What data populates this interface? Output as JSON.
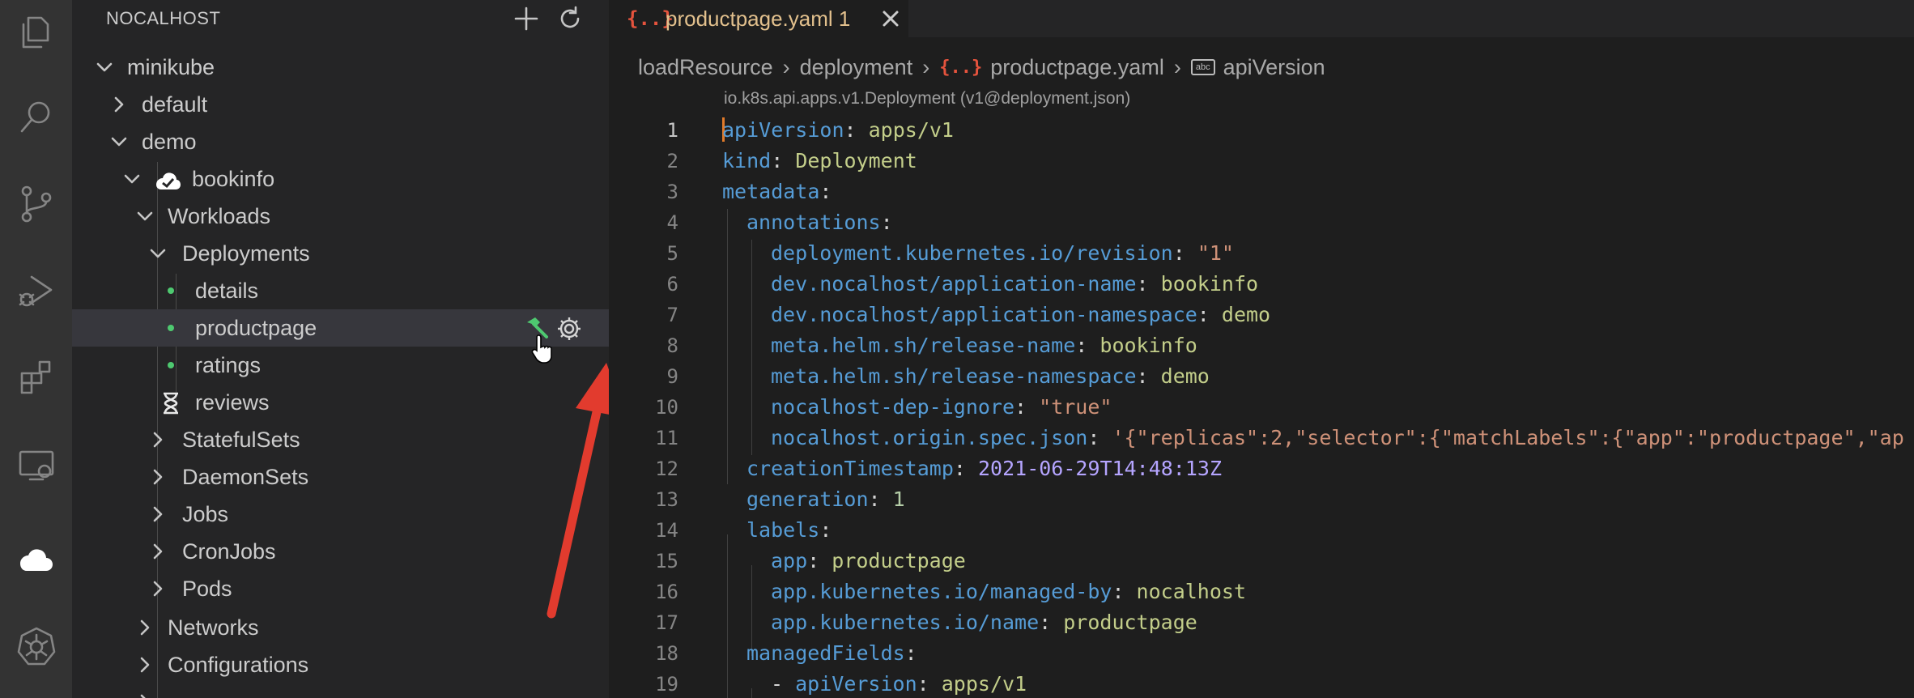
{
  "activity_bar": {
    "icons": [
      "explorer-icon",
      "search-icon",
      "source-control-icon",
      "run-debug-icon",
      "extensions-icon",
      "remote-explorer-icon",
      "nocalhost-icon",
      "kubernetes-icon"
    ]
  },
  "sidebar": {
    "title": "NOCALHOST",
    "tree": [
      {
        "label": "minikube"
      },
      {
        "label": "default"
      },
      {
        "label": "demo"
      },
      {
        "label": "bookinfo"
      },
      {
        "label": "Workloads"
      },
      {
        "label": "Deployments"
      },
      {
        "label": "details"
      },
      {
        "label": "productpage"
      },
      {
        "label": "ratings"
      },
      {
        "label": "reviews"
      },
      {
        "label": "StatefulSets"
      },
      {
        "label": "DaemonSets"
      },
      {
        "label": "Jobs"
      },
      {
        "label": "CronJobs"
      },
      {
        "label": "Pods"
      },
      {
        "label": "Networks"
      },
      {
        "label": "Configurations"
      }
    ],
    "status_color": "#4ec970"
  },
  "editor": {
    "tab": {
      "icon": "{..}",
      "title": "productpage.yaml 1"
    },
    "breadcrumb": [
      "loadResource",
      "deployment",
      "productpage.yaml",
      "apiVersion"
    ],
    "codelens": "io.k8s.api.apps.v1.Deployment (v1@deployment.json)",
    "lines": [
      {
        "n": "1",
        "k": "apiVersion",
        "v": "apps/v1"
      },
      {
        "n": "2",
        "k": "kind",
        "v": "Deployment"
      },
      {
        "n": "3",
        "k": "metadata",
        "v": ""
      },
      {
        "n": "4",
        "k": "annotations",
        "v": ""
      },
      {
        "n": "5",
        "k": "deployment.kubernetes.io/revision",
        "v": "\"1\""
      },
      {
        "n": "6",
        "k": "dev.nocalhost/application-name",
        "v": "bookinfo"
      },
      {
        "n": "7",
        "k": "dev.nocalhost/application-namespace",
        "v": "demo"
      },
      {
        "n": "8",
        "k": "meta.helm.sh/release-name",
        "v": "bookinfo"
      },
      {
        "n": "9",
        "k": "meta.helm.sh/release-namespace",
        "v": "demo"
      },
      {
        "n": "10",
        "k": "nocalhost-dep-ignore",
        "v": "\"true\""
      },
      {
        "n": "11",
        "k": "nocalhost.origin.spec.json",
        "v": "'{\"replicas\":2,\"selector\":{\"matchLabels\":{\"app\":\"productpage\",\"ap"
      },
      {
        "n": "12",
        "k": "creationTimestamp",
        "v": "2021-06-29T14:48:13Z"
      },
      {
        "n": "13",
        "k": "generation",
        "v": "1"
      },
      {
        "n": "14",
        "k": "labels",
        "v": ""
      },
      {
        "n": "15",
        "k": "app",
        "v": "productpage"
      },
      {
        "n": "16",
        "k": "app.kubernetes.io/managed-by",
        "v": "nocalhost"
      },
      {
        "n": "17",
        "k": "app.kubernetes.io/name",
        "v": "productpage"
      },
      {
        "n": "18",
        "k": "managedFields",
        "v": ""
      },
      {
        "n": "19",
        "k": "apiVersion",
        "v": "apps/v1",
        "dash": "- "
      }
    ]
  },
  "colors": {
    "accent_arrow": "#e23b2e",
    "tab_title": "#e2c08d",
    "yaml_icon": "#e5533d"
  }
}
